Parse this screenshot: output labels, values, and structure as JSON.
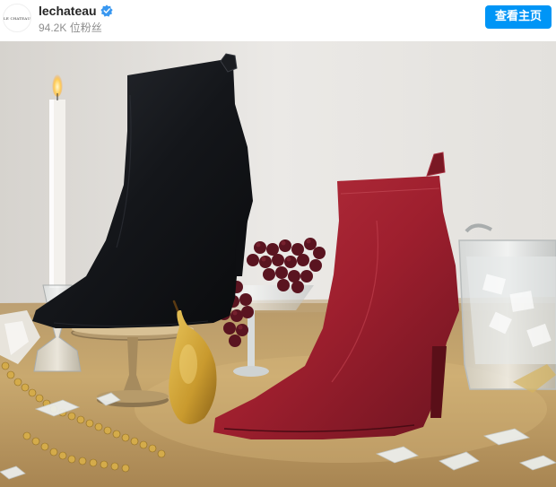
{
  "post_header": {
    "avatar_text": "LE CHATEAU",
    "username": "lechateau",
    "followers": "94.2K 位粉丝",
    "view_profile_label": "查看主页"
  },
  "colors": {
    "accent": "#0095f6",
    "verified": "#3897f0"
  },
  "icons": {
    "verified": "verified-badge-icon"
  }
}
